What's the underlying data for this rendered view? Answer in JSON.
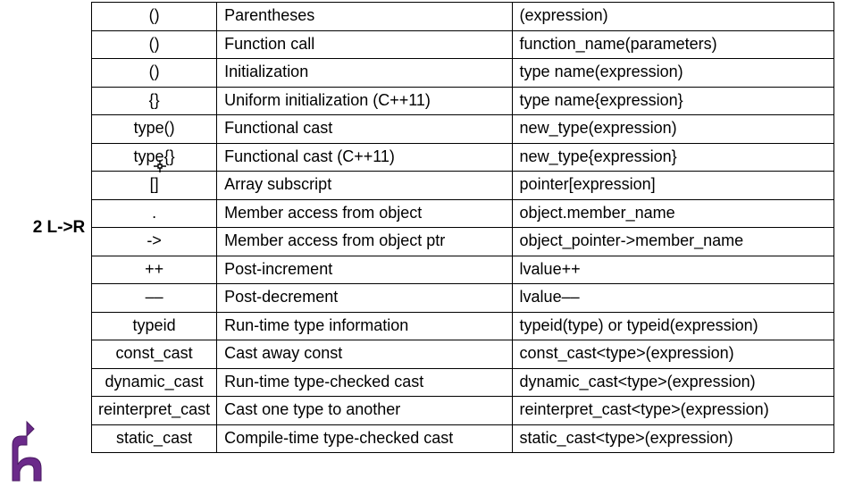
{
  "group_label": "2 L->R",
  "rows": [
    {
      "operator": "()",
      "description": "Parentheses",
      "pattern": "(expression)"
    },
    {
      "operator": "()",
      "description": "Function call",
      "pattern": "function_name(parameters)"
    },
    {
      "operator": "()",
      "description": "Initialization",
      "pattern": "type name(expression)"
    },
    {
      "operator": "{}",
      "description": "Uniform initialization (C++11)",
      "pattern": "type name{expression}"
    },
    {
      "operator": "type()",
      "description": "Functional cast",
      "pattern": "new_type(expression)"
    },
    {
      "operator": "type{}",
      "description": "Functional cast (C++11)",
      "pattern": "new_type{expression}"
    },
    {
      "operator": "[]",
      "description": "Array subscript",
      "pattern": "pointer[expression]"
    },
    {
      "operator": ".",
      "description": "Member access from object",
      "pattern": "object.member_name"
    },
    {
      "operator": "->",
      "description": "Member access from object ptr",
      "pattern": "object_pointer->member_name"
    },
    {
      "operator": "++",
      "description": "Post-increment",
      "pattern": "lvalue++"
    },
    {
      "operator": "––",
      "description": "Post-decrement",
      "pattern": "lvalue––"
    },
    {
      "operator": "typeid",
      "description": "Run-time type information",
      "pattern": "typeid(type) or typeid(expression)"
    },
    {
      "operator": "const_cast",
      "description": "Cast away const",
      "pattern": "const_cast<type>(expression)"
    },
    {
      "operator": "dynamic_cast",
      "description": "Run-time type-checked cast",
      "pattern": "dynamic_cast<type>(expression)"
    },
    {
      "operator": "reinterpret_cast",
      "description": "Cast one type to another",
      "pattern": "reinterpret_cast<type>(expression)"
    },
    {
      "operator": "static_cast",
      "description": "Compile-time type-checked cast",
      "pattern": "static_cast<type>(expression)"
    }
  ]
}
